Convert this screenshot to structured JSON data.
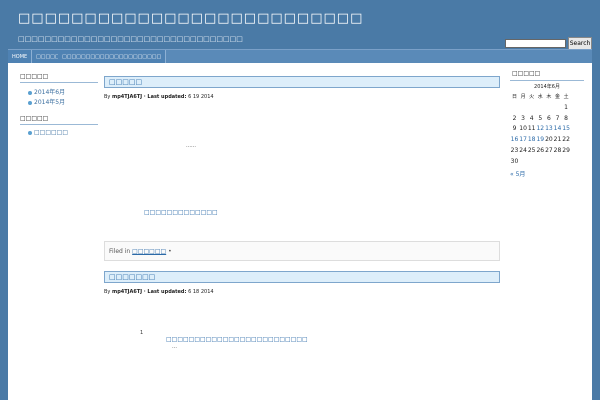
{
  "header": {
    "site_title": "□□□□□□□□□□□□□□□□□□□□□□□□□□",
    "site_description": "□□□□□□□□□□□□□□□□□□□□□□□□□□□□□□□□□□",
    "search_button": "Search",
    "search_value": ""
  },
  "nav": {
    "items": [
      "HOME",
      "□□□□□",
      "□□□□□□□□□□□□□□□□□□□□□"
    ]
  },
  "sidebar_left": {
    "archives_title": "□□□□□",
    "archives": [
      "2014年6月",
      "2014年5月"
    ],
    "categories_title": "□□□□□",
    "categories": [
      "□□□□□□"
    ]
  },
  "posts": [
    {
      "title": "□□□□□",
      "by_label": "By",
      "author": "mp4TJA6TJ",
      "updated_label": "· Last updated:",
      "date": "6  19  2014",
      "excerpt": "……",
      "link": "□□□□□□□□□□□□□",
      "filed_label": "Filed in",
      "filed_category": "□□□□□□",
      "filed_suffix": "•"
    },
    {
      "title": "□□□□□□□",
      "by_label": "By",
      "author": "mp4TJA6TJ",
      "updated_label": "· Last updated:",
      "date": "6  18  2014",
      "number": "1",
      "link": "□□□□□□□□□□□□□□□□□□□□□□□□□",
      "excerpt": "…"
    }
  ],
  "calendar": {
    "title": "□□□□□",
    "caption": "2014年6月",
    "weekdays": [
      "日",
      "月",
      "火",
      "水",
      "木",
      "金",
      "土"
    ],
    "rows": [
      [
        "",
        "",
        "",
        "",
        "",
        "",
        "1"
      ],
      [
        "2",
        "3",
        "4",
        "5",
        "6",
        "7",
        "8"
      ],
      [
        "9",
        "10",
        "11",
        "12",
        "13",
        "14",
        "15"
      ],
      [
        "16",
        "17",
        "18",
        "19",
        "20",
        "21",
        "22"
      ],
      [
        "23",
        "24",
        "25",
        "26",
        "27",
        "28",
        "29"
      ],
      [
        "30",
        "",
        "",
        "",
        "",
        "",
        ""
      ]
    ],
    "linked_days": [
      "12",
      "13",
      "14",
      "15",
      "16",
      "17",
      "18",
      "19"
    ],
    "prev_link": "« 5月"
  }
}
